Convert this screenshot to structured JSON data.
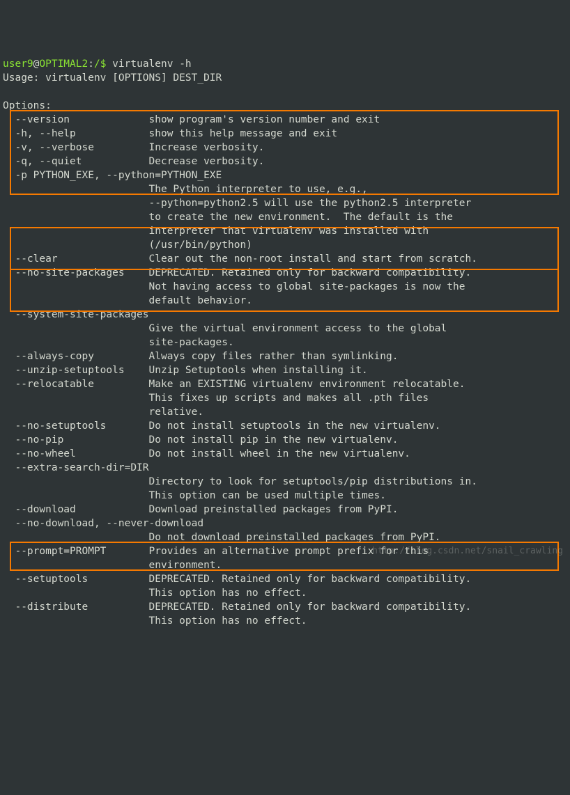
{
  "prompt": {
    "user": "user9",
    "host": "OPTIMAL2",
    "path": "/",
    "symbol": "$",
    "command": "virtualenv -h"
  },
  "output": {
    "usage": "Usage: virtualenv [OPTIONS] DEST_DIR",
    "options_header": "Options:",
    "lines": [
      "  --version             show program's version number and exit",
      "  -h, --help            show this help message and exit",
      "  -v, --verbose         Increase verbosity.",
      "  -q, --quiet           Decrease verbosity.",
      "  -p PYTHON_EXE, --python=PYTHON_EXE",
      "                        The Python interpreter to use, e.g.,",
      "                        --python=python2.5 will use the python2.5 interpreter",
      "                        to create the new environment.  The default is the",
      "                        interpreter that virtualenv was installed with",
      "                        (/usr/bin/python)",
      "  --clear               Clear out the non-root install and start from scratch.",
      "  --no-site-packages    DEPRECATED. Retained only for backward compatibility.",
      "                        Not having access to global site-packages is now the",
      "                        default behavior.",
      "  --system-site-packages",
      "                        Give the virtual environment access to the global",
      "                        site-packages.",
      "  --always-copy         Always copy files rather than symlinking.",
      "  --unzip-setuptools    Unzip Setuptools when installing it.",
      "  --relocatable         Make an EXISTING virtualenv environment relocatable.",
      "                        This fixes up scripts and makes all .pth files",
      "                        relative.",
      "  --no-setuptools       Do not install setuptools in the new virtualenv.",
      "  --no-pip              Do not install pip in the new virtualenv.",
      "  --no-wheel            Do not install wheel in the new virtualenv.",
      "  --extra-search-dir=DIR",
      "                        Directory to look for setuptools/pip distributions in.",
      "                        This option can be used multiple times.",
      "  --download            Download preinstalled packages from PyPI.",
      "  --no-download, --never-download",
      "                        Do not download preinstalled packages from PyPI.",
      "  --prompt=PROMPT       Provides an alternative prompt prefix for this",
      "                        environment.",
      "  --setuptools          DEPRECATED. Retained only for backward compatibility.",
      "                        This option has no effect.",
      "  --distribute          DEPRECATED. Retained only for backward compatibility.",
      "                        This option has no effect."
    ]
  },
  "watermark": "http://blog.csdn.net/snail_crawling"
}
